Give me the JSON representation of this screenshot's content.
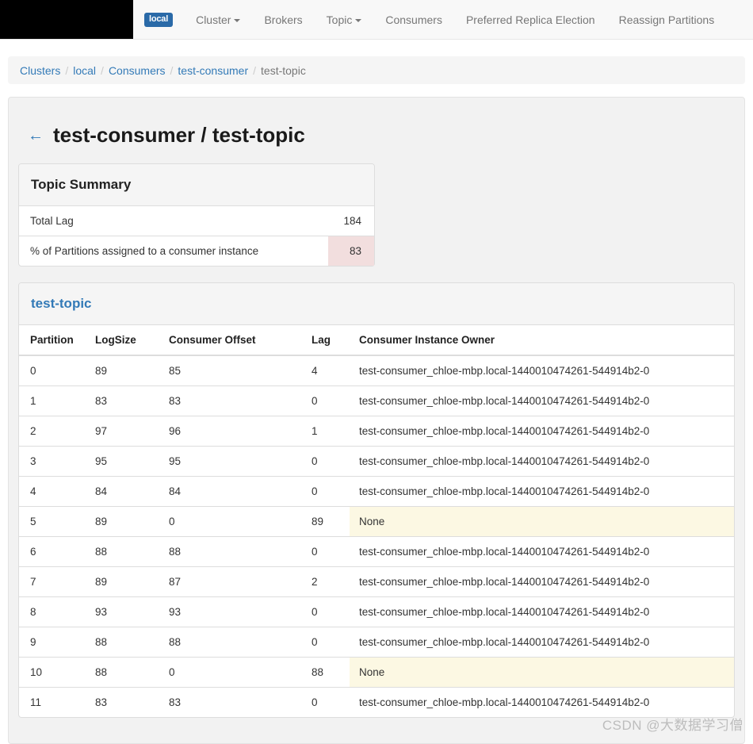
{
  "navbar": {
    "badge_label": "local",
    "items": [
      {
        "label": "Cluster",
        "caret": true
      },
      {
        "label": "Brokers",
        "caret": false
      },
      {
        "label": "Topic",
        "caret": true
      },
      {
        "label": "Consumers",
        "caret": false
      },
      {
        "label": "Preferred Replica Election",
        "caret": false
      },
      {
        "label": "Reassign Partitions",
        "caret": false
      }
    ]
  },
  "breadcrumb": {
    "items": [
      {
        "label": "Clusters",
        "link": true
      },
      {
        "label": "local",
        "link": true
      },
      {
        "label": "Consumers",
        "link": true
      },
      {
        "label": "test-consumer",
        "link": true
      },
      {
        "label": "test-topic",
        "link": false
      }
    ],
    "separator": "/"
  },
  "page": {
    "back_icon": "←",
    "title": "test-consumer / test-topic"
  },
  "summary_panel": {
    "title": "Topic Summary",
    "rows": [
      {
        "label": "Total Lag",
        "value": "184",
        "status": ""
      },
      {
        "label": "% of Partitions assigned to a consumer instance",
        "value": "83",
        "status": "danger"
      }
    ]
  },
  "topic_panel": {
    "title": "test-topic",
    "columns": [
      "Partition",
      "LogSize",
      "Consumer Offset",
      "Lag",
      "Consumer Instance Owner"
    ],
    "rows": [
      {
        "partition": "0",
        "logsize": "89",
        "offset": "85",
        "lag": "4",
        "owner": "test-consumer_chloe-mbp.local-1440010474261-544914b2-0",
        "owner_status": ""
      },
      {
        "partition": "1",
        "logsize": "83",
        "offset": "83",
        "lag": "0",
        "owner": "test-consumer_chloe-mbp.local-1440010474261-544914b2-0",
        "owner_status": ""
      },
      {
        "partition": "2",
        "logsize": "97",
        "offset": "96",
        "lag": "1",
        "owner": "test-consumer_chloe-mbp.local-1440010474261-544914b2-0",
        "owner_status": ""
      },
      {
        "partition": "3",
        "logsize": "95",
        "offset": "95",
        "lag": "0",
        "owner": "test-consumer_chloe-mbp.local-1440010474261-544914b2-0",
        "owner_status": ""
      },
      {
        "partition": "4",
        "logsize": "84",
        "offset": "84",
        "lag": "0",
        "owner": "test-consumer_chloe-mbp.local-1440010474261-544914b2-0",
        "owner_status": ""
      },
      {
        "partition": "5",
        "logsize": "89",
        "offset": "0",
        "lag": "89",
        "owner": "None",
        "owner_status": "warning"
      },
      {
        "partition": "6",
        "logsize": "88",
        "offset": "88",
        "lag": "0",
        "owner": "test-consumer_chloe-mbp.local-1440010474261-544914b2-0",
        "owner_status": ""
      },
      {
        "partition": "7",
        "logsize": "89",
        "offset": "87",
        "lag": "2",
        "owner": "test-consumer_chloe-mbp.local-1440010474261-544914b2-0",
        "owner_status": ""
      },
      {
        "partition": "8",
        "logsize": "93",
        "offset": "93",
        "lag": "0",
        "owner": "test-consumer_chloe-mbp.local-1440010474261-544914b2-0",
        "owner_status": ""
      },
      {
        "partition": "9",
        "logsize": "88",
        "offset": "88",
        "lag": "0",
        "owner": "test-consumer_chloe-mbp.local-1440010474261-544914b2-0",
        "owner_status": ""
      },
      {
        "partition": "10",
        "logsize": "88",
        "offset": "0",
        "lag": "88",
        "owner": "None",
        "owner_status": "warning"
      },
      {
        "partition": "11",
        "logsize": "83",
        "offset": "83",
        "lag": "0",
        "owner": "test-consumer_chloe-mbp.local-1440010474261-544914b2-0",
        "owner_status": ""
      }
    ]
  },
  "watermark": {
    "text": "CSDN @大数据学习僧"
  },
  "colors": {
    "brand_badge": "#2a6aa8",
    "link": "#337ab7",
    "danger_bg": "#f2dede",
    "warning_bg": "#fcf8e3",
    "panel_border": "#dddddd",
    "well_bg": "#f2f2f2"
  }
}
